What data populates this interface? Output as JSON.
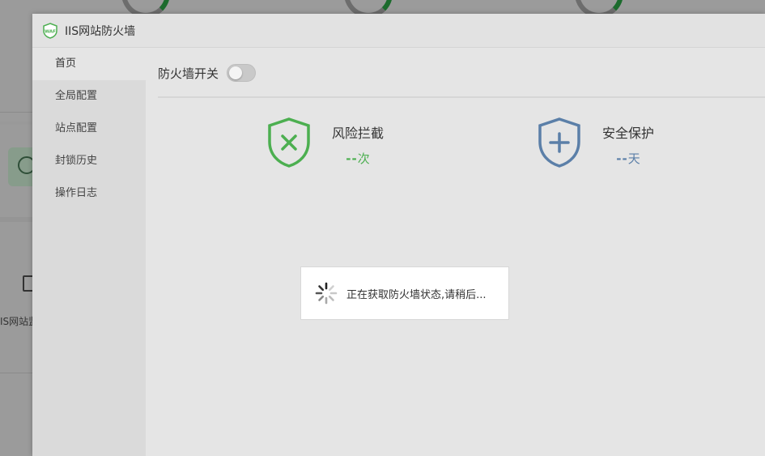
{
  "background": {
    "partial_label": "IS网站监"
  },
  "dialog": {
    "title": "IIS网站防火墙",
    "logo_text": "WAF"
  },
  "sidebar": {
    "items": [
      {
        "label": "首页",
        "active": true
      },
      {
        "label": "全局配置",
        "active": false
      },
      {
        "label": "站点配置",
        "active": false
      },
      {
        "label": "封锁历史",
        "active": false
      },
      {
        "label": "操作日志",
        "active": false
      }
    ]
  },
  "main": {
    "firewall_switch_label": "防火墙开关",
    "firewall_switch_on": false,
    "stats": [
      {
        "title": "风险拦截",
        "value": "--",
        "unit": "次",
        "color": "#4caf50",
        "icon": "shield-x-icon"
      },
      {
        "title": "安全保护",
        "value": "--",
        "unit": "天",
        "color": "#5b7fa8",
        "icon": "shield-plus-icon"
      }
    ],
    "loading_text": "正在获取防火墙状态,请稍后..."
  },
  "colors": {
    "green": "#4caf50",
    "blue": "#5b7fa8",
    "bg_ring_green": "#1c6b2d"
  }
}
